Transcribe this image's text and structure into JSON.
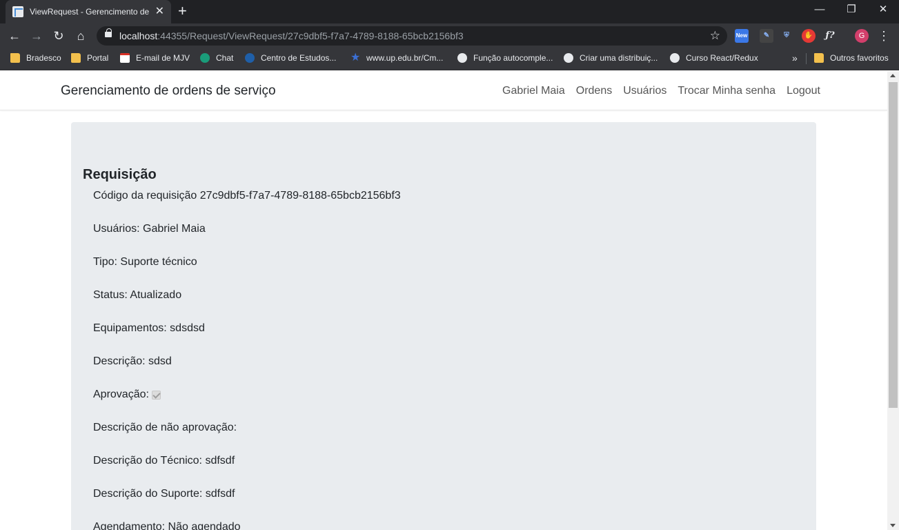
{
  "browser": {
    "tab_title": "ViewRequest - Gerencimento de",
    "url_host": "localhost",
    "url_path": ":44355/Request/ViewRequest/27c9dbf5-f7a7-4789-8188-65bcb2156bf3",
    "extension_new_label": "New",
    "avatar_initial": "G",
    "bookmarks": [
      {
        "label": "Bradesco",
        "icon": "folder-icon"
      },
      {
        "label": "Portal",
        "icon": "folder-icon"
      },
      {
        "label": "E-mail de MJV",
        "icon": "gmail-icon"
      },
      {
        "label": "Chat",
        "icon": "chat-icon"
      },
      {
        "label": "Centro de Estudos...",
        "icon": "site-icon"
      },
      {
        "label": "www.up.edu.br/Cm...",
        "icon": "star-site-icon"
      },
      {
        "label": "Função autocomple...",
        "icon": "github-icon"
      },
      {
        "label": "Criar uma distribuiç...",
        "icon": "github-icon"
      },
      {
        "label": "Curso React/Redux",
        "icon": "github-icon"
      }
    ],
    "bookmarks_more": "»",
    "other_bookmarks": "Outros favoritos"
  },
  "navbar": {
    "brand": "Gerenciamento de ordens de serviço",
    "links": [
      "Gabriel Maia",
      "Ordens",
      "Usuários",
      "Trocar Minha senha",
      "Logout"
    ]
  },
  "request": {
    "title": "Requisição",
    "code": "Código da requisição 27c9dbf5-f7a7-4789-8188-65bcb2156bf3",
    "users": "Usuários: Gabriel Maia",
    "type": "Tipo: Suporte técnico",
    "status": "Status: Atualizado",
    "equipment": "Equipamentos: sdsdsd",
    "description": "Descrição: sdsd",
    "approval_label": "Aprovação:",
    "approval_checked": true,
    "non_approval_description": "Descrição de não aprovação:",
    "technician_description": "Descrição do Técnico: sdfsdf",
    "support_description": "Descrição do Suporte: sdfsdf",
    "scheduling": "Agendamento: Não agendado"
  },
  "colors": {
    "chrome_dark": "#202124",
    "chrome_toolbar": "#35363a",
    "card_bg": "#e9ecef",
    "text": "#212529"
  }
}
